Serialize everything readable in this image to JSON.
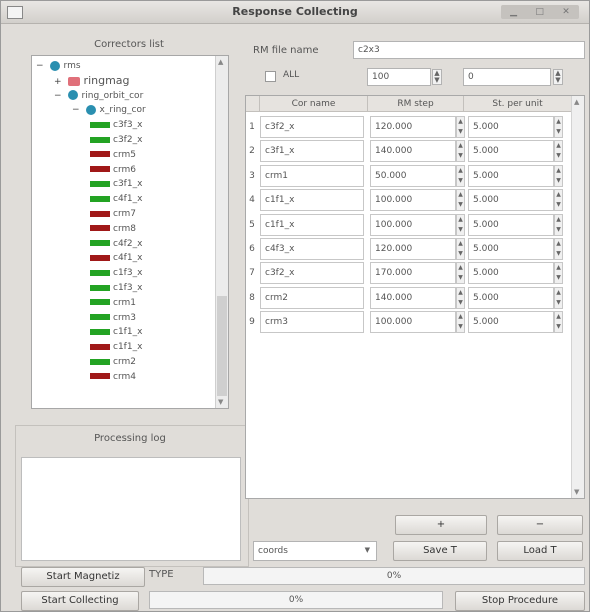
{
  "window": {
    "title": "Response Collecting"
  },
  "left": {
    "connectors_label": "Correctors list",
    "tree": [
      {
        "indent": 0,
        "toggle": "−",
        "icon": "node",
        "label": "rms"
      },
      {
        "indent": 1,
        "toggle": "+",
        "icon": "mag",
        "label": "ringmag"
      },
      {
        "indent": 1,
        "toggle": "−",
        "icon": "node",
        "label": "ring_orbit_cor"
      },
      {
        "indent": 2,
        "toggle": "−",
        "icon": "node",
        "label": "x_ring_cor"
      },
      {
        "indent": 3,
        "icon": "green",
        "label": "c3f3_x"
      },
      {
        "indent": 3,
        "icon": "green",
        "label": "c3f2_x"
      },
      {
        "indent": 3,
        "icon": "red",
        "label": "crm5"
      },
      {
        "indent": 3,
        "icon": "red",
        "label": "crm6"
      },
      {
        "indent": 3,
        "icon": "green",
        "label": "c3f1_x"
      },
      {
        "indent": 3,
        "icon": "green",
        "label": "c4f1_x"
      },
      {
        "indent": 3,
        "icon": "red",
        "label": "crm7"
      },
      {
        "indent": 3,
        "icon": "red",
        "label": "crm8"
      },
      {
        "indent": 3,
        "icon": "green",
        "label": "c4f2_x"
      },
      {
        "indent": 3,
        "icon": "red",
        "label": "c4f1_x"
      },
      {
        "indent": 3,
        "icon": "green",
        "label": "c1f3_x"
      },
      {
        "indent": 3,
        "icon": "green",
        "label": "c1f3_x"
      },
      {
        "indent": 3,
        "icon": "green",
        "label": "crm1"
      },
      {
        "indent": 3,
        "icon": "green",
        "label": "crm3"
      },
      {
        "indent": 3,
        "icon": "green",
        "label": "c1f1_x"
      },
      {
        "indent": 3,
        "icon": "red",
        "label": "c1f1_x"
      },
      {
        "indent": 3,
        "icon": "green",
        "label": "crm2"
      },
      {
        "indent": 3,
        "icon": "red",
        "label": "crm4"
      }
    ],
    "processing_label": "Processing log"
  },
  "right": {
    "rm_file_label": "RM file name",
    "rm_file_value": "c2x3",
    "all_label": "ALL",
    "spin1_value": "100",
    "spin2_value": "0",
    "table": {
      "headers": [
        "Cor name",
        "RM step",
        "St. per unit"
      ],
      "rows": [
        {
          "n": "1",
          "name": "c3f2_x",
          "step": "120.000",
          "unit": "5.000"
        },
        {
          "n": "2",
          "name": "c3f1_x",
          "step": "140.000",
          "unit": "5.000"
        },
        {
          "n": "3",
          "name": "crm1",
          "step": "50.000",
          "unit": "5.000"
        },
        {
          "n": "4",
          "name": "c1f1_x",
          "step": "100.000",
          "unit": "5.000"
        },
        {
          "n": "5",
          "name": "c1f1_x",
          "step": "100.000",
          "unit": "5.000"
        },
        {
          "n": "6",
          "name": "c4f3_x",
          "step": "120.000",
          "unit": "5.000"
        },
        {
          "n": "7",
          "name": "c3f2_x",
          "step": "170.000",
          "unit": "5.000"
        },
        {
          "n": "8",
          "name": "crm2",
          "step": "140.000",
          "unit": "5.000"
        },
        {
          "n": "9",
          "name": "crm3",
          "step": "100.000",
          "unit": "5.000"
        }
      ]
    },
    "btn_plus": "+",
    "btn_minus": "−",
    "combo_value": "coords",
    "save_label": "Save T",
    "load_label": "Load T"
  },
  "bottom": {
    "start_mag_label": "Start Magnetiz",
    "type_label": "TYPE",
    "progress1": "0%",
    "start_collect_label": "Start Collecting",
    "progress2": "0%",
    "stop_label": "Stop Procedure"
  },
  "colors": {
    "red_marker": "#a01818",
    "green_marker": "#23a323",
    "node_icon": "#2a8fb0"
  }
}
